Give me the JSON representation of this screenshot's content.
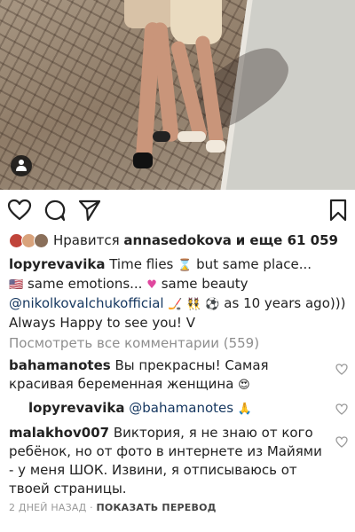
{
  "post": {
    "likes": {
      "prefix": "Нравится",
      "user": "annasedokova",
      "suffix": "и еще 61 059"
    },
    "caption": {
      "user": "lopyrevavika",
      "text1": "Time flies",
      "text2": "but same place...",
      "text3": "same emotions...",
      "text4": "same beauty",
      "mention": "@nikolkovalchukofficial",
      "text5": "as 10 years ago))) Always Happy to see you! V"
    },
    "view_comments": "Посмотреть все комментарии (559)",
    "comments": [
      {
        "user": "bahamanotes",
        "text": "Вы прекрасны! Самая красивая беременная женщина"
      },
      {
        "user": "lopyrevavika",
        "mention": "@bahamanotes",
        "text": ""
      },
      {
        "user": "malakhov007",
        "text": "Виктория, я не знаю от кого ребёнок, но от фото в интернете из Майями - у меня ШОК. Извини, я отписываюсь от твоей страницы."
      }
    ],
    "meta": {
      "time": "2 ДНЕЙ НАЗАД",
      "separator": "·",
      "translate": "ПОКАЗАТЬ ПЕРЕВОД"
    }
  },
  "icons": {
    "like": "heart-icon",
    "comment": "comment-icon",
    "share": "send-icon",
    "save": "bookmark-icon"
  }
}
